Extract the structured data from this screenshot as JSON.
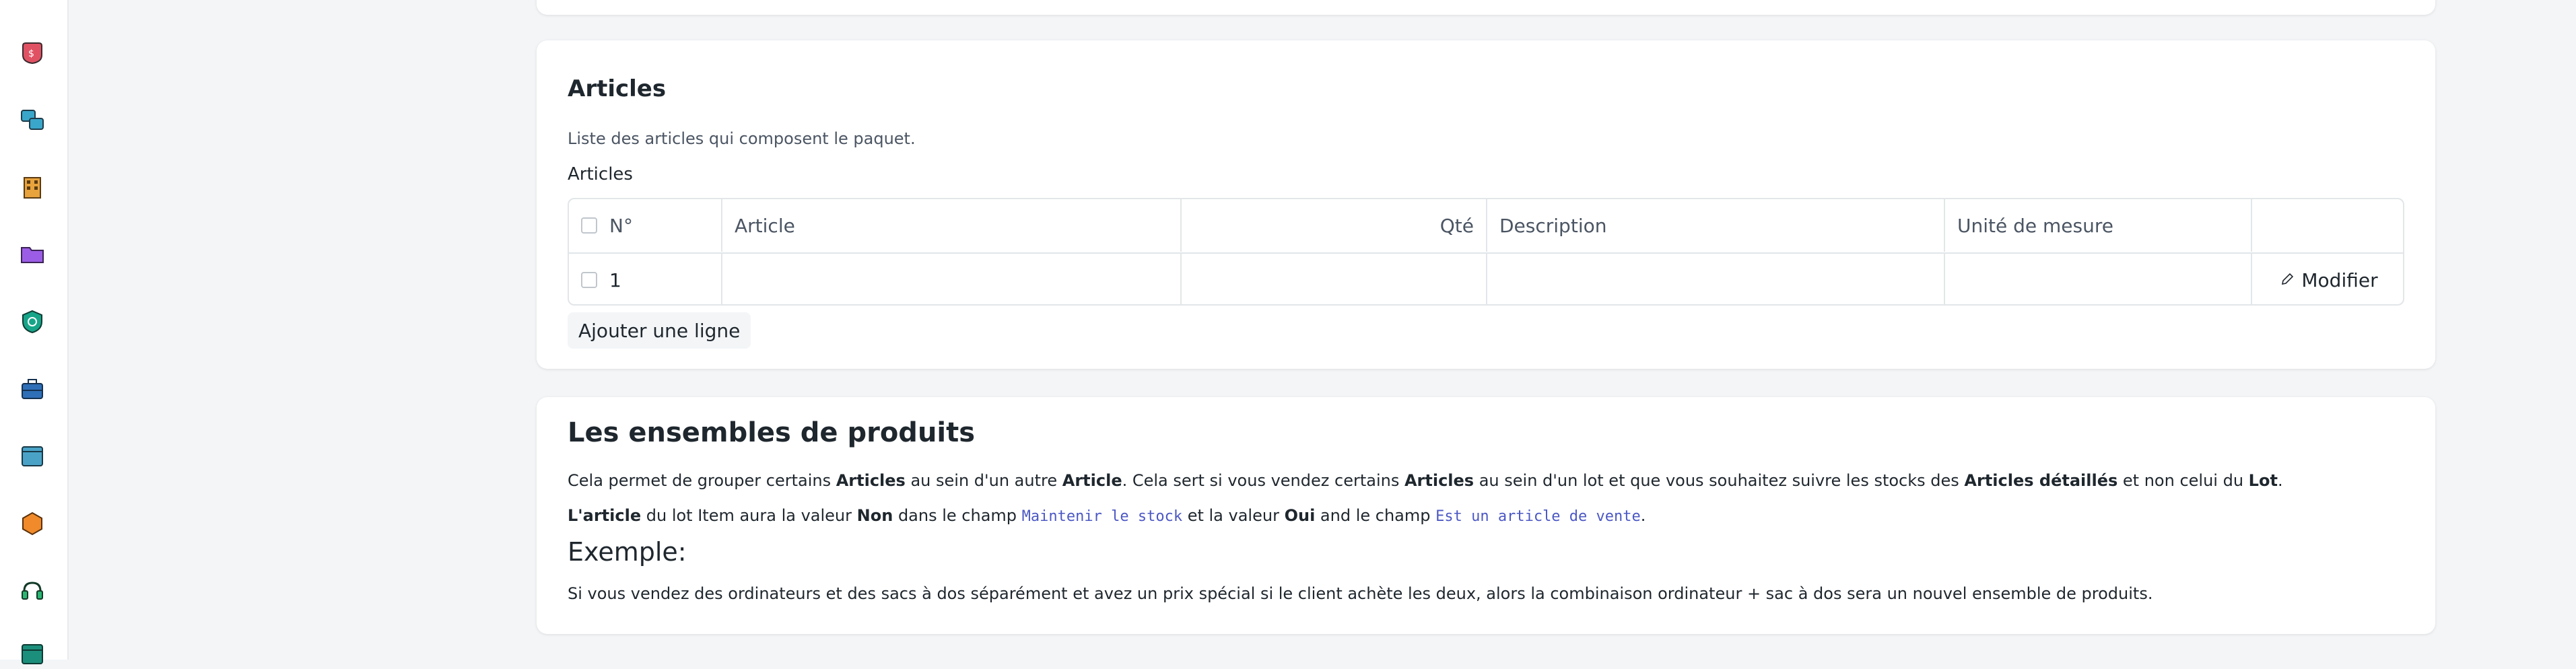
{
  "sidebar": {
    "icons": [
      {
        "name": "selling-icon",
        "color": "#e05263"
      },
      {
        "name": "stock-icon",
        "color": "#3aa6c9"
      },
      {
        "name": "buildings-icon",
        "color": "#e8a33d"
      },
      {
        "name": "folder-icon",
        "color": "#9b5de5"
      },
      {
        "name": "quality-shield-icon",
        "color": "#17a589"
      },
      {
        "name": "briefcase-icon",
        "color": "#2e6fb7"
      },
      {
        "name": "website-icon",
        "color": "#4aa3c7"
      },
      {
        "name": "hexagon-icon",
        "color": "#f08a2a"
      },
      {
        "name": "support-headset-icon",
        "color": "#2bb673"
      },
      {
        "name": "table-icon",
        "color": "#1c8f7c"
      }
    ]
  },
  "articles_section": {
    "title": "Articles",
    "description": "Liste des articles qui composent le paquet.",
    "field_label": "Articles",
    "columns": {
      "no": "N°",
      "article": "Article",
      "qty": "Qté",
      "description": "Description",
      "uom": "Unité de mesure"
    },
    "rows": [
      {
        "no": "1",
        "article": "",
        "qty": "",
        "description": "",
        "uom": "",
        "action": "Modifier"
      }
    ],
    "add_row_label": "Ajouter une ligne"
  },
  "ensembles_section": {
    "title": "Les ensembles de produits",
    "p1": {
      "t1": "Cela permet de grouper certains ",
      "b1": "Articles",
      "t2": " au sein d'un autre ",
      "b2": "Article",
      "t3": ". Cela sert si vous vendez certains ",
      "b3": "Articles",
      "t4": " au sein d'un lot et que vous souhaitez suivre les stocks des ",
      "b4": "Articles détaillés",
      "t5": " et non celui du ",
      "b5": "Lot",
      "t6": "."
    },
    "p2": {
      "b1": "L'article",
      "t1": " du lot Item aura la valeur ",
      "b2": "Non",
      "t2": " dans le champ ",
      "c1": "Maintenir le stock",
      "t3": " et la valeur ",
      "b3": "Oui",
      "t4": " and le champ ",
      "c2": "Est un article de vente",
      "t5": "."
    },
    "example_heading": "Exemple:",
    "p3": "Si vous vendez des ordinateurs et des sacs à dos séparément et avez un prix spécial si le client achète les deux, alors la combinaison ordinateur + sac à dos sera un nouvel ensemble de produits."
  }
}
